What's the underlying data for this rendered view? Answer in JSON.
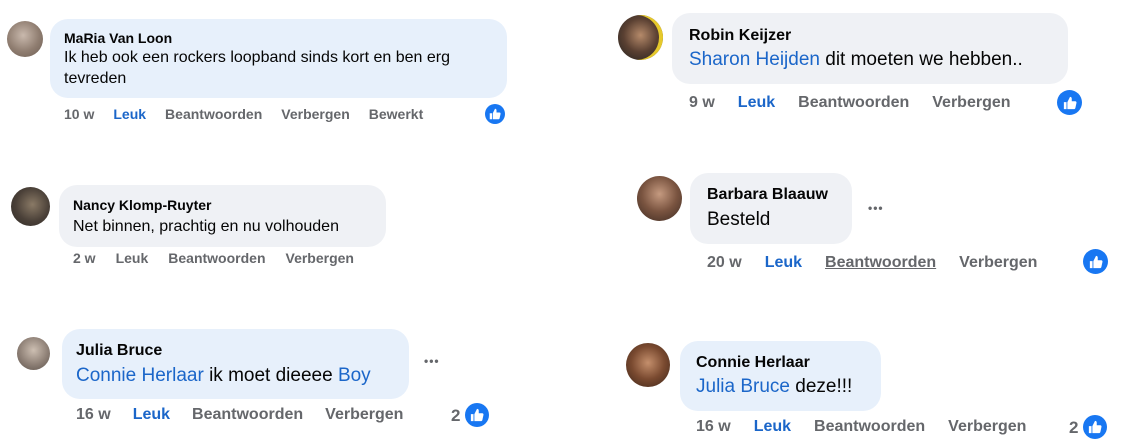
{
  "comments": [
    {
      "author": "MaRia Van Loon",
      "text_line1": "Ik heb ook een rockers loopband sinds kort en ben erg",
      "text_line2": "tevreden",
      "time": "10 w",
      "like": "Leuk",
      "reply": "Beantwoorden",
      "hide": "Verbergen",
      "edited": "Bewerkt"
    },
    {
      "author": "Nancy Klomp-Ruyter",
      "text": "Net binnen, prachtig en nu volhouden",
      "time": "2 w",
      "like": "Leuk",
      "reply": "Beantwoorden",
      "hide": "Verbergen"
    },
    {
      "author": "Julia Bruce",
      "mention1": "Connie Herlaar",
      "text_mid": " ik moet dieeee ",
      "mention2": "Boy",
      "time": "16 w",
      "like": "Leuk",
      "reply": "Beantwoorden",
      "hide": "Verbergen",
      "reactions": "2",
      "more": "•••"
    },
    {
      "author": "Robin Keijzer",
      "mention": "Sharon Heijden",
      "text": " dit moeten we hebben..",
      "time": "9 w",
      "like": "Leuk",
      "reply": "Beantwoorden",
      "hide": "Verbergen"
    },
    {
      "author": "Barbara Blaauw",
      "text": "Besteld",
      "time": "20 w",
      "like": "Leuk",
      "reply": "Beantwoorden",
      "hide": "Verbergen",
      "more": "•••"
    },
    {
      "author": "Connie Herlaar",
      "mention": "Julia Bruce",
      "text": " deze!!!",
      "time": "16 w",
      "like": "Leuk",
      "reply": "Beantwoorden",
      "hide": "Verbergen",
      "reactions": "2"
    }
  ],
  "colors": {
    "mention": "#1b66c9",
    "meta": "#65676b",
    "bubble_blue": "#e7f0fb",
    "bubble_grey": "#eff1f5",
    "reaction": "#1877f2"
  },
  "icons": {
    "reaction": "thumbs-up-icon",
    "avatar": "profile-photo",
    "more": "more-options-icon"
  }
}
